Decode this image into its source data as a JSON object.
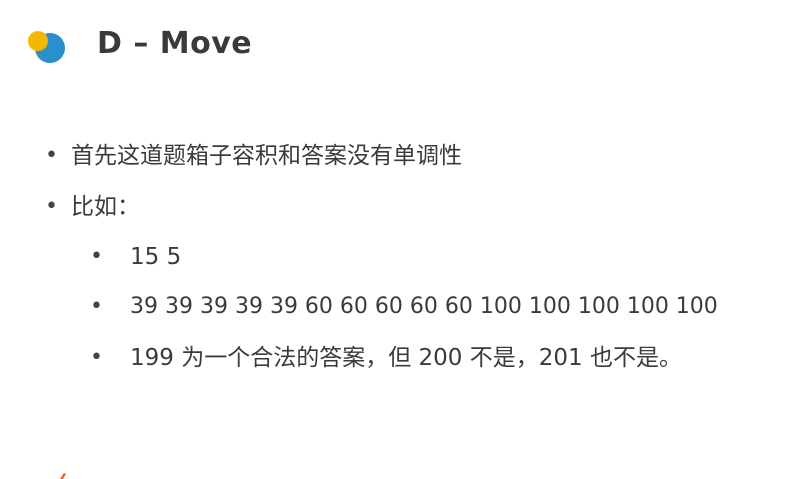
{
  "slide": {
    "title": "D – Move",
    "logo": {
      "icon": "two-overlapping-circles-logo",
      "colors": {
        "yellow": "#F5B800",
        "blue": "#2B8FCB"
      }
    },
    "bullets": [
      {
        "level": 1,
        "text": "首先这道题箱子容积和答案没有单调性"
      },
      {
        "level": 1,
        "text": "比如："
      },
      {
        "level": 2,
        "text": "15 5"
      },
      {
        "level": 2,
        "text": "39 39 39 39 39 60 60 60 60 60 100 100 100 100 100"
      },
      {
        "level": 2,
        "text": "199 为一个合法的答案，但 200 不是，201 也不是。"
      }
    ],
    "bullet_symbol": "•",
    "accent_color": "#E8641B"
  }
}
